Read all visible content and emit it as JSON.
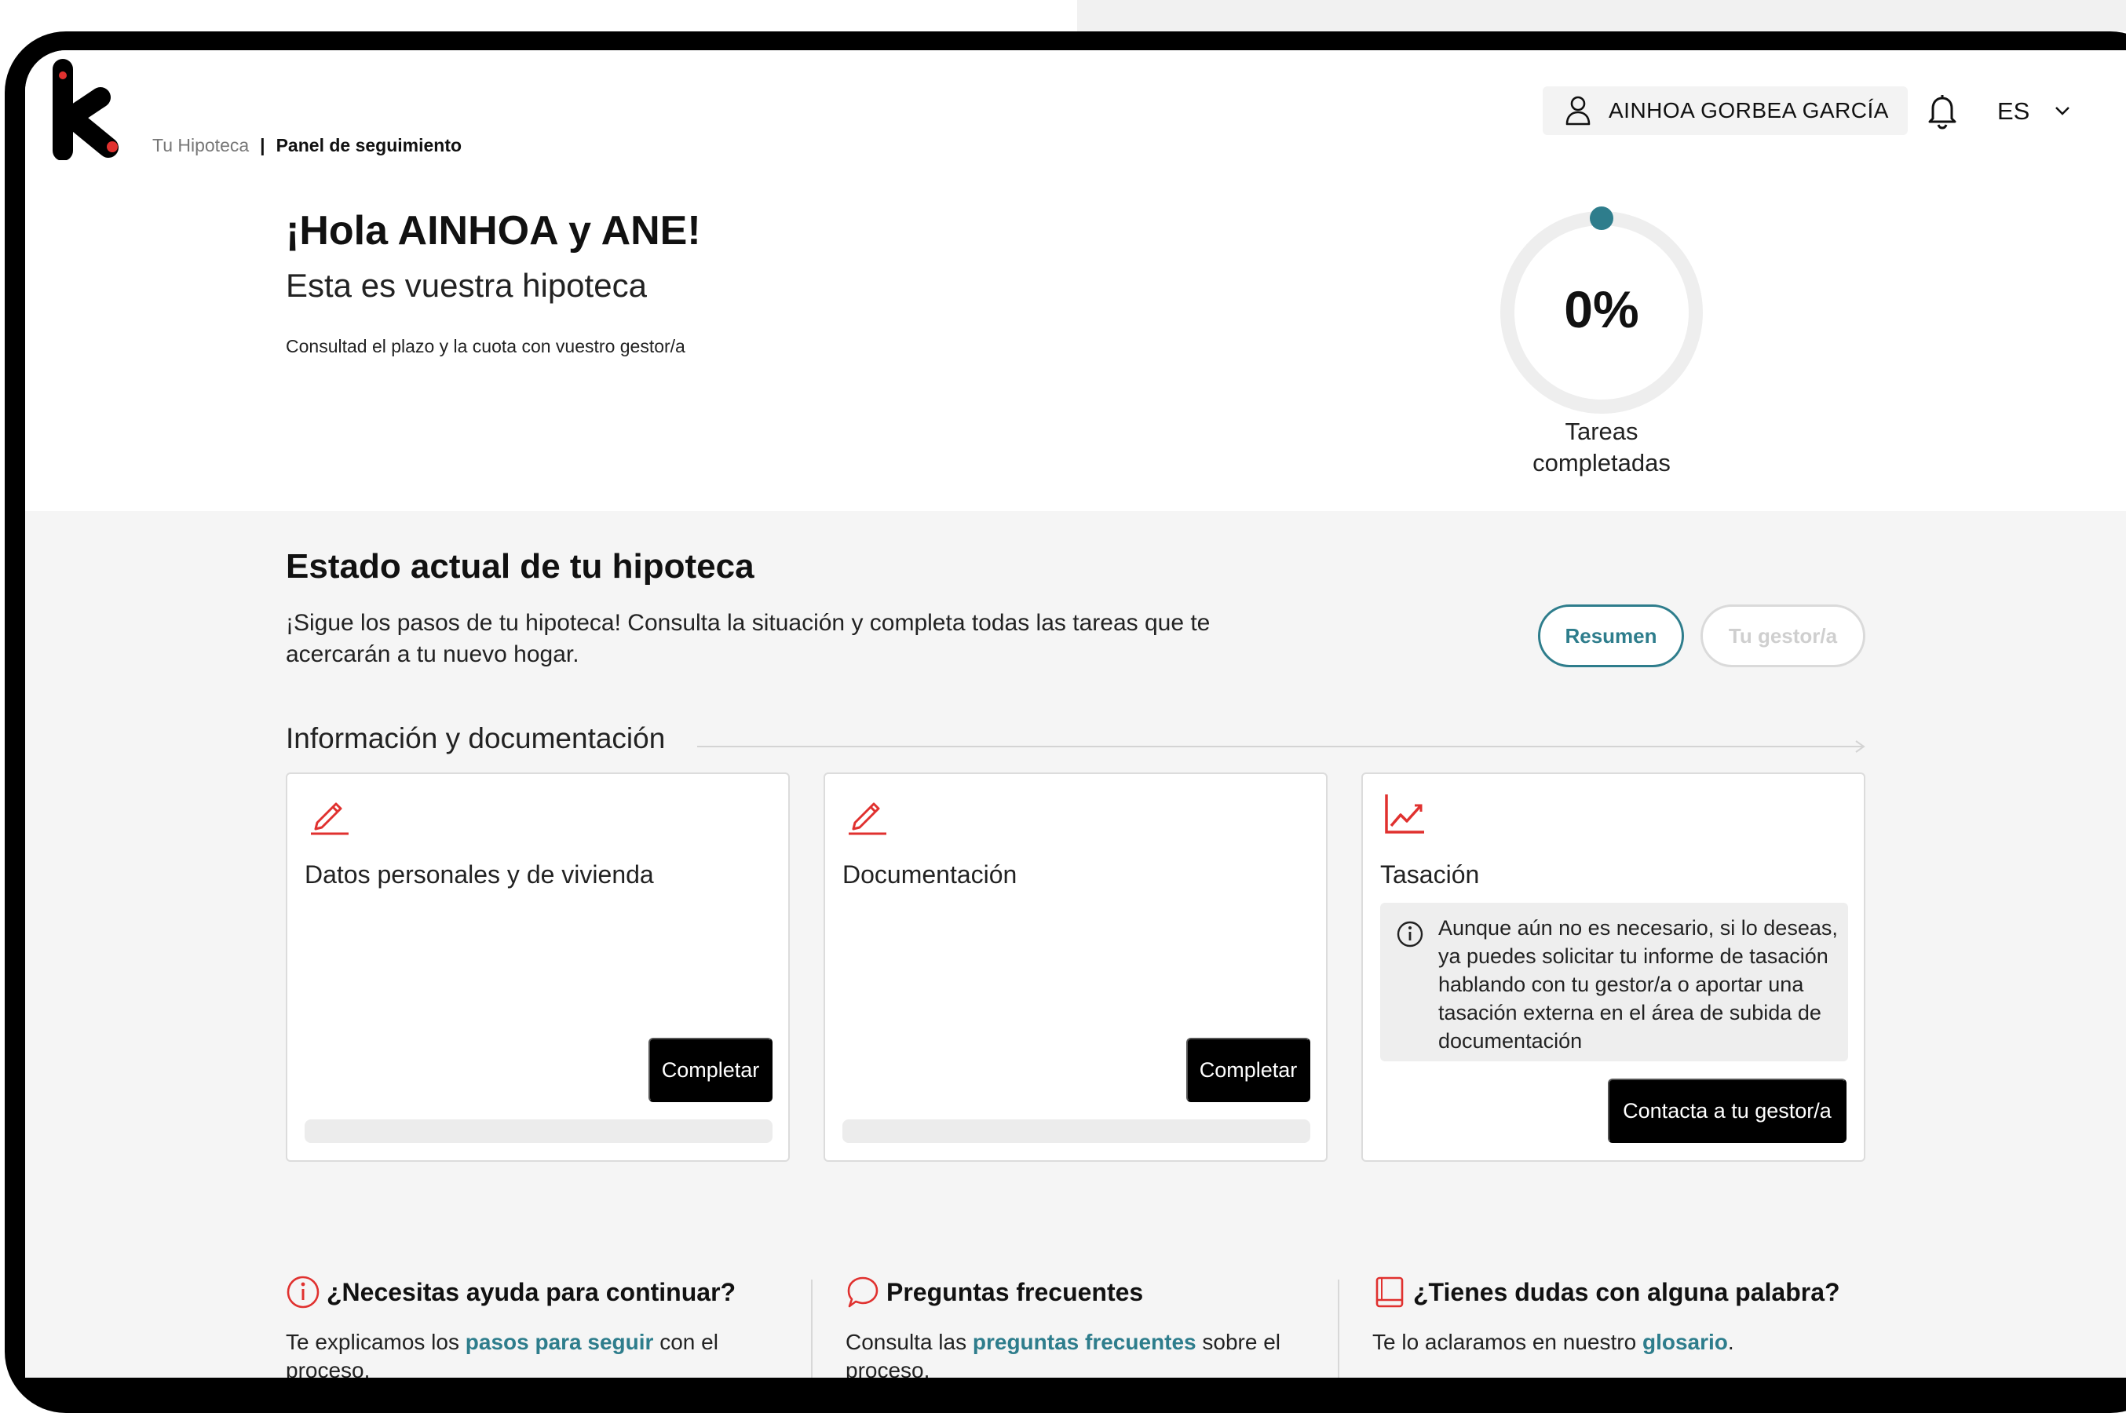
{
  "colors": {
    "accent": "#2e7d8c",
    "brand_red": "#e0312f",
    "black": "#000000",
    "panel_gray": "#f5f5f5"
  },
  "header": {
    "breadcrumb": {
      "root": "Tu Hipoteca",
      "separator": "|",
      "current": "Panel de seguimiento"
    },
    "user_name": "AINHOA GORBEA GARCÍA",
    "language": "ES",
    "icons": {
      "user": "user-icon",
      "notifications": "bell-icon",
      "dropdown": "chevron-down-icon"
    }
  },
  "hero": {
    "greeting": "¡Hola AINHOA y ANE!",
    "subtitle": "Esta es vuestra hipoteca",
    "note": "Consultad el plazo y la cuota con vuestro gestor/a",
    "progress": {
      "percent": 0,
      "value_text": "0%",
      "label_line1": "Tareas",
      "label_line2": "completadas"
    }
  },
  "status": {
    "title": "Estado actual de tu hipoteca",
    "description": "¡Sigue los pasos de tu hipoteca! Consulta la situación y completa todas las tareas que te acercarán a tu nuevo hogar.",
    "tabs": [
      {
        "label": "Resumen",
        "active": true
      },
      {
        "label": "Tu gestor/a",
        "active": false
      }
    ]
  },
  "info": {
    "title": "Información y documentación",
    "cards": [
      {
        "icon": "pencil-icon",
        "title": "Datos personales y de vivienda",
        "button": "Completar",
        "progress": 0
      },
      {
        "icon": "pencil-icon",
        "title": "Documentación",
        "button": "Completar",
        "progress": 0
      },
      {
        "icon": "chart-line-icon",
        "title": "Tasación",
        "notice": "Aunque aún no es necesario, si lo deseas, ya puedes solicitar tu informe de tasación hablando con tu gestor/a o aportar una tasación externa en el área de subida de documentación",
        "button": "Contacta a tu gestor/a"
      }
    ]
  },
  "help": [
    {
      "icon": "info-circle-icon",
      "title": "¿Necesitas ayuda para continuar?",
      "pre": "Te explicamos los ",
      "link": "pasos para seguir",
      "post": " con el proceso."
    },
    {
      "icon": "chat-bubble-icon",
      "title": "Preguntas frecuentes",
      "pre": "Consulta las ",
      "link": "preguntas frecuentes",
      "post": " sobre el proceso."
    },
    {
      "icon": "book-icon",
      "title": "¿Tienes dudas con alguna palabra?",
      "pre": "Te lo aclaramos en nuestro ",
      "link": "glosario",
      "post": "."
    }
  ]
}
